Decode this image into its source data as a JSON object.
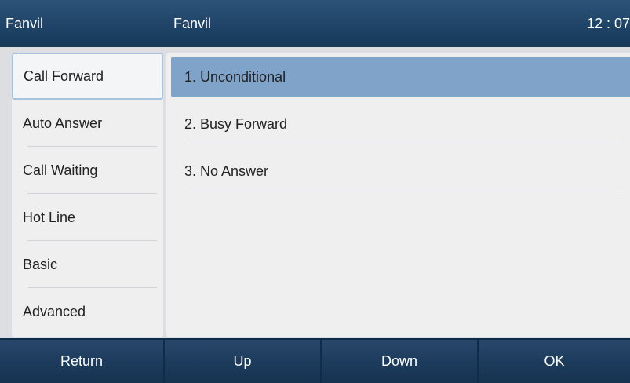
{
  "topbar": {
    "left_title": "Fanvil",
    "center_title": "Fanvil",
    "time": "12 : 07"
  },
  "sidebar": {
    "items": [
      {
        "label": "Call Forward",
        "active": true
      },
      {
        "label": "Auto Answer"
      },
      {
        "label": "Call Waiting"
      },
      {
        "label": "Hot Line"
      },
      {
        "label": "Basic"
      },
      {
        "label": "Advanced"
      }
    ]
  },
  "content": {
    "items": [
      {
        "label": "1.  Unconditional",
        "active": true
      },
      {
        "label": "2.  Busy Forward"
      },
      {
        "label": "3.  No Answer"
      }
    ]
  },
  "softkeys": [
    {
      "label": "Return"
    },
    {
      "label": "Up"
    },
    {
      "label": "Down"
    },
    {
      "label": "OK"
    }
  ],
  "colors": {
    "topbar": "#1f4468",
    "selected_list_item": "#7fa3c9",
    "selected_sidebar_border": "#a9c3de",
    "softkey_bar": "#163350"
  }
}
